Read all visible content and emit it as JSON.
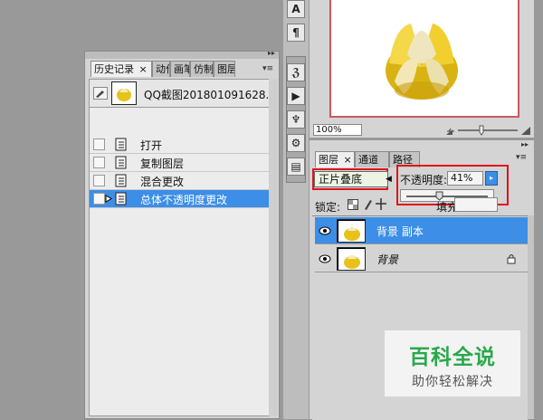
{
  "history_panel": {
    "tabs": [
      "历史记录",
      "动作",
      "画笔",
      "仿制源",
      "图层复合"
    ],
    "close_glyph": "×",
    "snapshot_label": "QQ截图201801091628...",
    "items": [
      {
        "label": "打开"
      },
      {
        "label": "复制图层"
      },
      {
        "label": "混合更改"
      },
      {
        "label": "总体不透明度更改"
      }
    ],
    "selected_index": 3
  },
  "navigator": {
    "zoom": "100%"
  },
  "layers_panel": {
    "tabs": [
      "图层",
      "通道",
      "路径"
    ],
    "close_glyph": "×",
    "blend_mode": "正片叠底",
    "opacity_label": "不透明度:",
    "opacity_value": "41%",
    "opacity_fraction": 0.41,
    "lock_label": "锁定:",
    "fill_label": "填充",
    "layers": [
      {
        "name": "背景 副本",
        "selected": true
      },
      {
        "name": "背景",
        "selected": false
      }
    ]
  },
  "watermark": {
    "title": "百科全说",
    "subtitle": "助你轻松解决"
  },
  "colors": {
    "selection": "#3c8ee6",
    "highlight_red": "#e0141e",
    "brand_green": "#2aa84a"
  }
}
